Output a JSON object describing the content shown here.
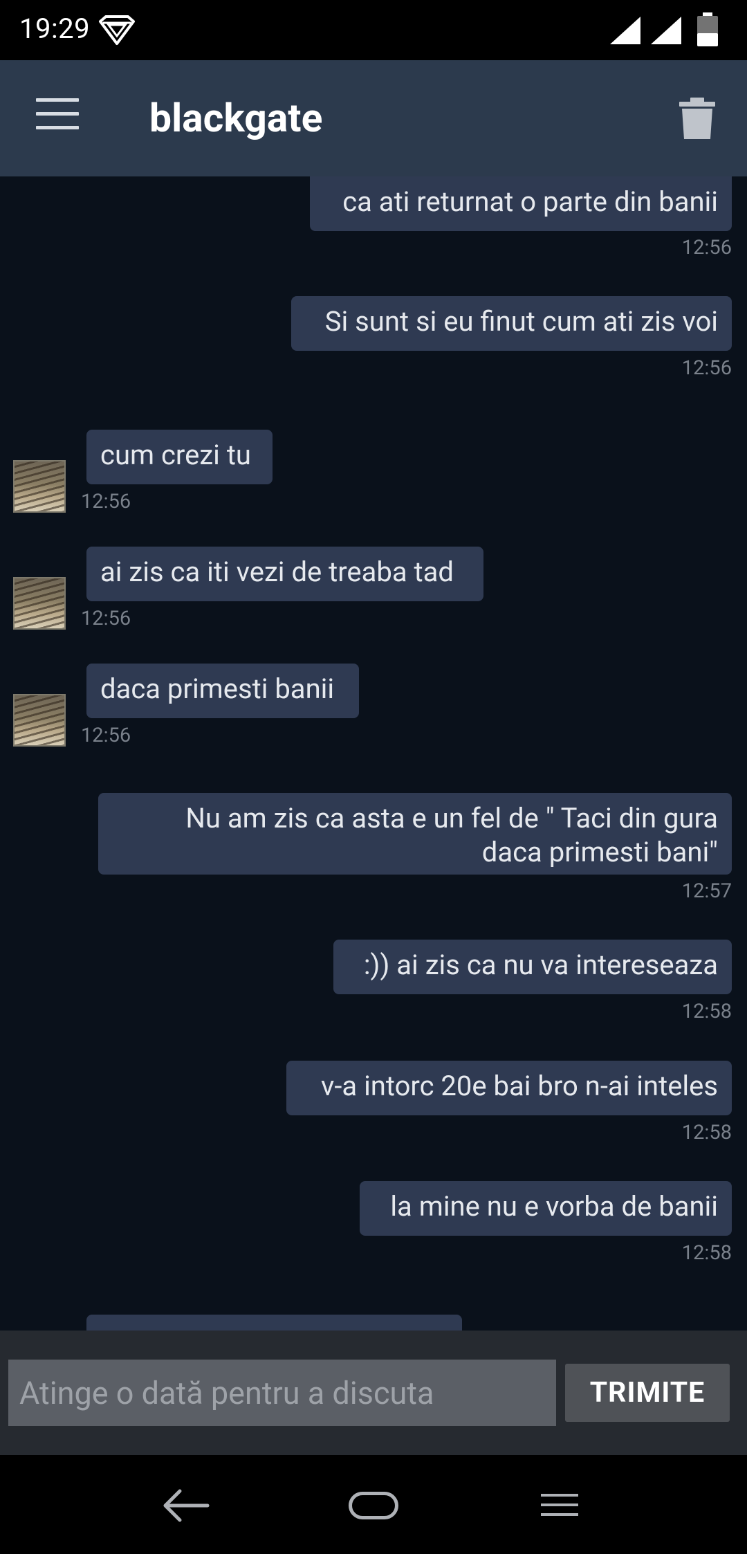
{
  "status_bar": {
    "time": "19:29"
  },
  "app_bar": {
    "title": "blackgate"
  },
  "messages": [
    {
      "direction": "out",
      "text": "ca ati returnat o parte din banii",
      "time": "12:56"
    },
    {
      "direction": "out",
      "text": "Si sunt si eu finut cum ati zis voi",
      "time": "12:56"
    },
    {
      "direction": "in",
      "text": "cum crezi tu",
      "time": "12:56"
    },
    {
      "direction": "in",
      "text": "ai zis ca iti vezi de treaba tad",
      "time": "12:56"
    },
    {
      "direction": "in",
      "text": "daca primesti banii",
      "time": "12:56"
    },
    {
      "direction": "out",
      "line1": "Nu am zis ca asta e un fel de \" Taci din gura",
      "line2": "daca primesti bani\"",
      "time": "12:57"
    },
    {
      "direction": "out",
      "text": ":)) ai zis ca nu va intereseaza",
      "time": "12:58"
    },
    {
      "direction": "out",
      "text": "v-a intorc 20e bai bro n-ai inteles",
      "time": "12:58"
    },
    {
      "direction": "out",
      "text": "la mine nu e vorba de banii",
      "time": "12:58"
    }
  ],
  "composer": {
    "placeholder": "Atinge o dată pentru a discuta",
    "send_label": "TRIMITE"
  },
  "colors": {
    "background": "#0a111b",
    "app_bar": "#2c3a4d",
    "bubble": "#2f3a52",
    "timestamp": "#7a818b"
  },
  "icons": [
    "menu-icon",
    "trash-icon",
    "back-icon",
    "home-icon",
    "recent-apps-icon"
  ]
}
